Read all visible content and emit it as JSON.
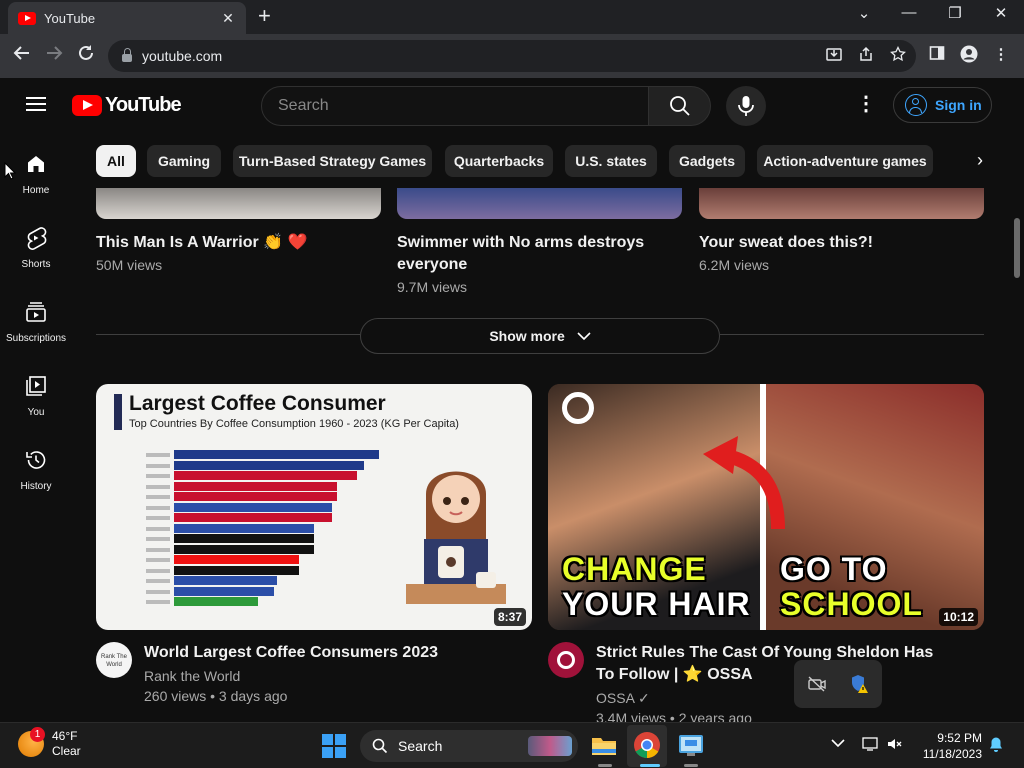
{
  "browser": {
    "tab_title": "YouTube",
    "tab_close": "✕",
    "new_tab": "+",
    "url": "youtube.com",
    "window_controls": [
      "⌄",
      "—",
      "❐",
      "✕"
    ]
  },
  "header": {
    "logo_text": "YouTube",
    "search_placeholder": "Search",
    "signin_label": "Sign in"
  },
  "sidebar": {
    "items": [
      {
        "label": "Home",
        "icon": "home-icon"
      },
      {
        "label": "Shorts",
        "icon": "shorts-icon"
      },
      {
        "label": "Subscriptions",
        "icon": "subscriptions-icon"
      },
      {
        "label": "You",
        "icon": "you-icon"
      },
      {
        "label": "History",
        "icon": "history-icon"
      }
    ]
  },
  "chips": [
    "All",
    "Gaming",
    "Turn-Based Strategy Games",
    "Quarterbacks",
    "U.S. states",
    "Gadgets",
    "Action-adventure games"
  ],
  "shorts": [
    {
      "title": "This Man Is A Warrior 👏 ❤️",
      "views": "50M views"
    },
    {
      "title": "Swimmer with No arms destroys everyone",
      "views": "9.7M views"
    },
    {
      "title": "Your sweat does this?!",
      "views": "6.2M views"
    }
  ],
  "show_more": "Show more",
  "videos": [
    {
      "title": "World Largest Coffee Consumers 2023",
      "channel": "Rank the World",
      "meta": "260 views • 3 days ago",
      "duration": "8:37",
      "avatar_text": "Rank The World",
      "thumb_title": "Largest Coffee Consumer",
      "thumb_subtitle": "Top Countries By Coffee Consumption 1960 - 2023 (KG Per Capita)"
    },
    {
      "title": "Strict Rules The Cast Of Young Sheldon Has To Follow | ⭐ OSSA",
      "channel": "OSSA ✓",
      "meta": "3.4M views • 2 years ago",
      "duration": "10:12",
      "thumb_text_left_1": "CHANGE",
      "thumb_text_left_2": "YOUR HAIR",
      "thumb_text_right_1": "GO TO",
      "thumb_text_right_2": "SCHOOL"
    }
  ],
  "taskbar": {
    "weather_temp": "46°F",
    "weather_desc": "Clear",
    "weather_badge": "1",
    "search_label": "Search",
    "time": "9:52 PM",
    "date": "11/18/2023"
  },
  "colors": {
    "yt_red": "#ff0000",
    "link_blue": "#3ea6ff",
    "background": "#0f0f0f"
  }
}
